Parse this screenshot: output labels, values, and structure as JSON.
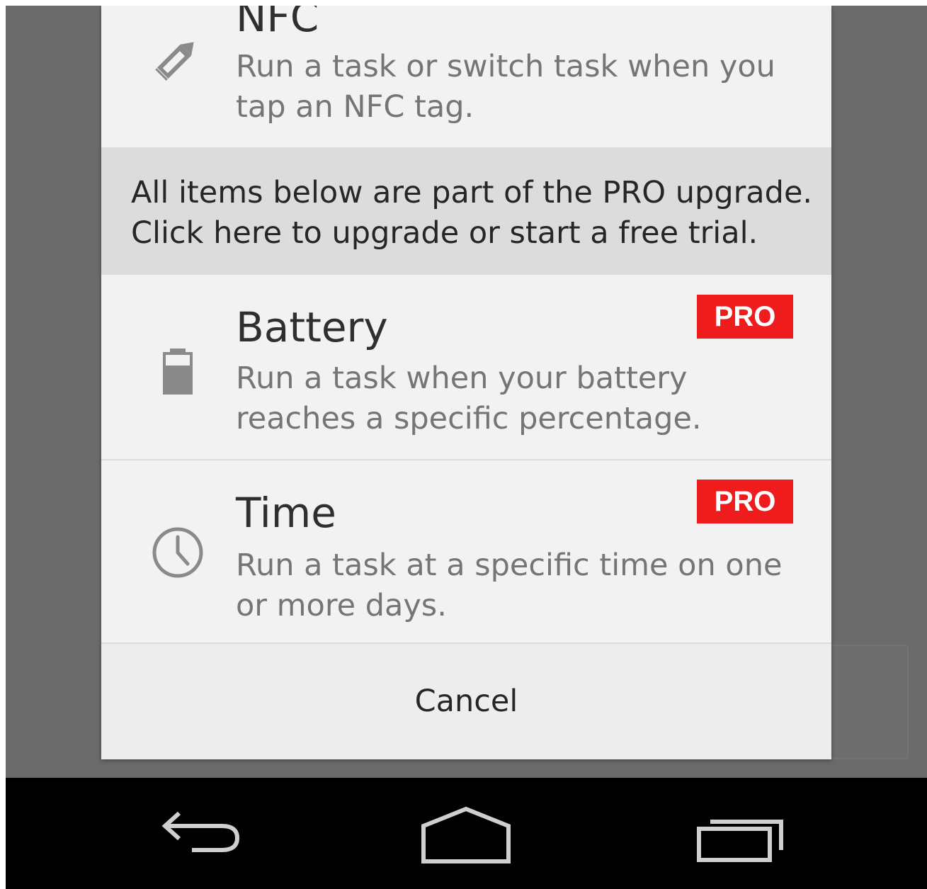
{
  "dialog": {
    "items": [
      {
        "title": "NFC",
        "description": "Run a task or switch task when you tap an NFC tag.",
        "icon": "pencil-icon",
        "pro": false
      },
      {
        "title": "Battery",
        "description": "Run a task when your battery reaches a specific percentage.",
        "icon": "battery-icon",
        "pro": true
      },
      {
        "title": "Time",
        "description": "Run a task at a specific time on one or more days.",
        "icon": "clock-icon",
        "pro": true
      }
    ],
    "pro_banner": "All items below are part of the PRO upgrade. Click here to upgrade or start a free trial.",
    "pro_badge_label": "PRO",
    "cancel_label": "Cancel"
  },
  "navbar": {
    "icons": [
      "back-icon",
      "home-icon",
      "recents-icon"
    ]
  },
  "colors": {
    "pro_badge": "#ee1c1c",
    "dialog_bg": "#f2f2f2",
    "banner_bg": "#dcdcdc",
    "scrim": "#6b6b6b",
    "navbar": "#000000"
  }
}
